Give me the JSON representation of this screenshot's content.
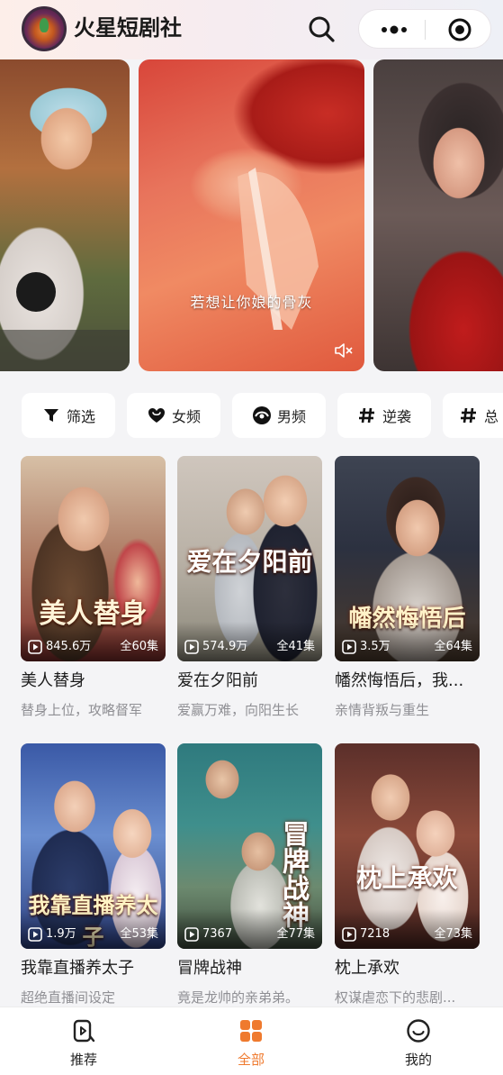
{
  "header": {
    "app_title": "火星短剧社",
    "icons": {
      "search": "search-icon",
      "more": "more-dots-icon",
      "target": "target-circle-icon"
    }
  },
  "carousel": {
    "subtitle": "若想让你娘的骨灰",
    "mute_icon": "muted-speaker-icon"
  },
  "filters": [
    {
      "label": "筛选",
      "icon": "funnel-icon"
    },
    {
      "label": "女频",
      "icon": "heart-icon"
    },
    {
      "label": "男频",
      "icon": "male-channel-icon"
    },
    {
      "label": "逆袭",
      "icon": "hash-icon"
    },
    {
      "label": "总",
      "icon": "hash-icon"
    }
  ],
  "dramas": [
    {
      "title": "美人替身",
      "subtitle": "替身上位，攻略督军",
      "views": "845.6万",
      "episodes": "全60集",
      "poster_text": "美人替身"
    },
    {
      "title": "爱在夕阳前",
      "subtitle": "爱赢万难，向阳生长",
      "views": "574.9万",
      "episodes": "全41集",
      "poster_text": "爱在夕阳前"
    },
    {
      "title": "幡然悔悟后，我...",
      "subtitle": "亲情背叛与重生",
      "views": "3.5万",
      "episodes": "全64集",
      "poster_text": "幡然悔悟后"
    },
    {
      "title": "我靠直播养太子",
      "subtitle": "超绝直播间设定",
      "views": "1.9万",
      "episodes": "全53集",
      "poster_text": "我靠直播养太子"
    },
    {
      "title": "冒牌战神",
      "subtitle": "竟是龙帅的亲弟弟。",
      "views": "7367",
      "episodes": "全77集",
      "poster_text": "冒牌战神"
    },
    {
      "title": "枕上承欢",
      "subtitle": "权谋虐恋下的悲剧...",
      "views": "7218",
      "episodes": "全73集",
      "poster_text": "枕上承欢"
    }
  ],
  "bottom_nav": [
    {
      "label": "推荐",
      "icon": "recommend-icon",
      "active": false
    },
    {
      "label": "全部",
      "icon": "grid-icon",
      "active": true
    },
    {
      "label": "我的",
      "icon": "smiley-profile-icon",
      "active": false
    }
  ],
  "colors": {
    "accent": "#ef7a2e",
    "background": "#f4f4f6"
  }
}
